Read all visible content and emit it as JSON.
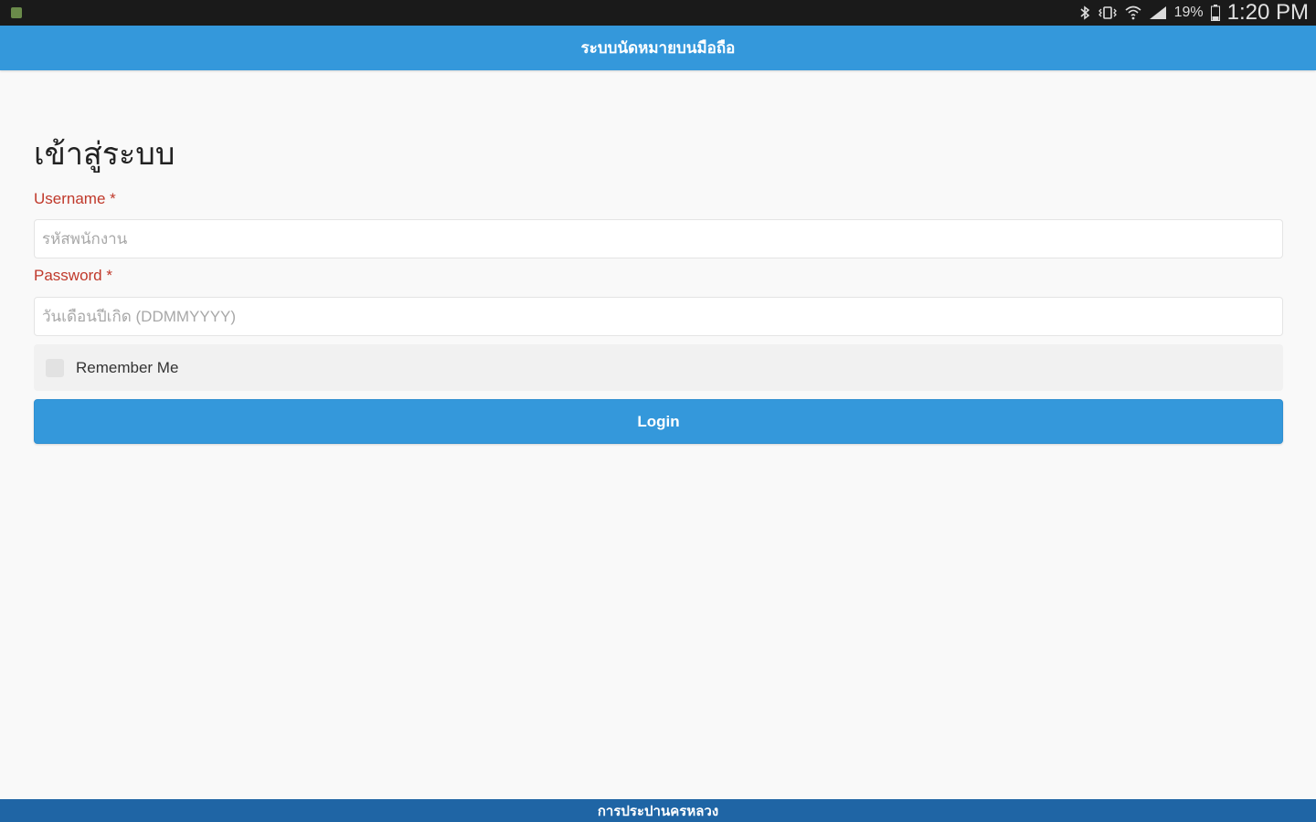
{
  "status_bar": {
    "battery_percent": "19%",
    "time": "1:20 PM",
    "icons": [
      "notification-icon",
      "bluetooth-icon",
      "vibrate-icon",
      "wifi-icon",
      "signal-icon",
      "battery-icon"
    ]
  },
  "header": {
    "title": "ระบบนัดหมายบนมือถือ"
  },
  "login_form": {
    "title": "เข้าสู่ระบบ",
    "username_label": "Username *",
    "username_placeholder": "รหัสพนักงาน",
    "username_value": "",
    "password_label": "Password *",
    "password_placeholder": "วันเดือนปีเกิด (DDMMYYYY)",
    "password_value": "",
    "remember_label": "Remember Me",
    "remember_checked": false,
    "login_label": "Login"
  },
  "footer": {
    "text": "การประปานครหลวง"
  },
  "colors": {
    "primary": "#3498db",
    "footer": "#1f65a5",
    "label_red": "#c0392b",
    "status_bar": "#1a1a1a"
  }
}
